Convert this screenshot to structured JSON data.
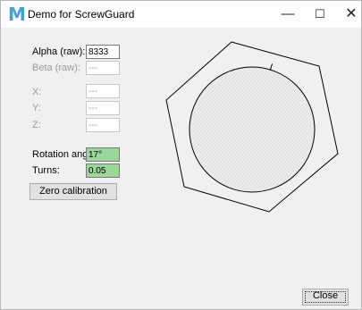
{
  "window": {
    "title": "Demo for ScrewGuard",
    "logo_letter": "M"
  },
  "controls": {
    "minimize": "—",
    "maximize": "☐",
    "close": "✕"
  },
  "fields": {
    "alpha_label": "Alpha (raw):",
    "alpha_value": "8333",
    "beta_label": "Beta (raw):",
    "beta_value": "---",
    "x_label": "X:",
    "x_value": "---",
    "y_label": "Y:",
    "y_value": "---",
    "z_label": "Z:",
    "z_value": "---",
    "rotation_label": "Rotation angle:",
    "rotation_value": "17°",
    "turns_label": "Turns:",
    "turns_value": "0.05"
  },
  "buttons": {
    "zero_calibration": "Zero calibration",
    "close": "Close"
  },
  "dial": {
    "rotation_deg": 17,
    "outline_color": "#000000"
  }
}
